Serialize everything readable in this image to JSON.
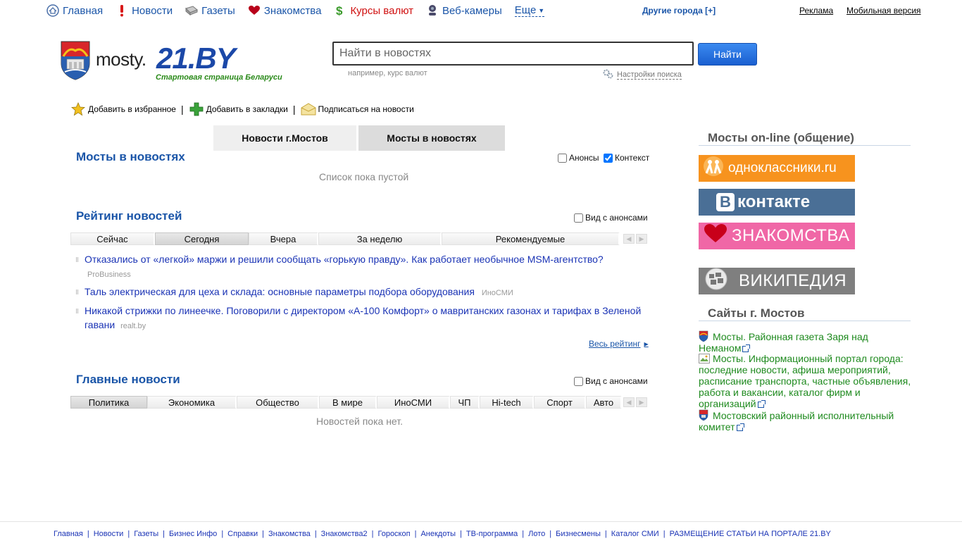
{
  "topnav": {
    "items": [
      {
        "label": "Главная",
        "icon": "home-icon"
      },
      {
        "label": "Новости",
        "icon": "exclamation-icon"
      },
      {
        "label": "Газеты",
        "icon": "newspaper-icon"
      },
      {
        "label": "Знакомства",
        "icon": "heart-icon"
      },
      {
        "label": "Курсы валют",
        "icon": "dollar-icon"
      },
      {
        "label": "Веб-камеры",
        "icon": "webcam-icon"
      }
    ],
    "more_label": "Еще",
    "other_cities": "Другие города [+]",
    "ads": "Реклама",
    "mobile": "Мобильная версия"
  },
  "logo": {
    "city": "mosty.",
    "brand": "21.BY",
    "slogan": "Стартовая страница Беларуси"
  },
  "search": {
    "placeholder": "Найти в новостях",
    "button": "Найти",
    "hint": "например, курс валют",
    "settings": "Настройки поиска"
  },
  "actions": {
    "favorites": "Добавить в избранное",
    "bookmarks": "Добавить в закладки",
    "subscribe": "Подписаться на новости"
  },
  "tabs": {
    "city_news": "Новости г.Мостов",
    "mosty_news": "Мосты в новостях"
  },
  "mosty_section": {
    "title": "Мосты в новостях",
    "announcements_label": "Анонсы",
    "context_label": "Контекст",
    "empty": "Список пока пустой"
  },
  "rating": {
    "title": "Рейтинг новостей",
    "with_announcements": "Вид с анонсами",
    "tabs": [
      "Сейчас",
      "Сегодня",
      "Вчера",
      "За неделю",
      "Рекомендуемые"
    ],
    "news": [
      {
        "title": "Отказались от «легкой» маржи и решили сообщать «горькую правду». Как работает необычное MSM-агентство?",
        "source": "ProBusiness"
      },
      {
        "title": "Таль электрическая для цеха и склада: основные параметры подбора оборудования",
        "source": "ИноСМИ"
      },
      {
        "title": "Никакой стрижки по линеечке. Поговорили с директором «А-100 Комфорт» о мавританских газонах и тарифах в Зеленой гавани",
        "source": "realt.by"
      }
    ],
    "all_link": "Весь рейтинг"
  },
  "main_news": {
    "title": "Главные новости",
    "with_announcements": "Вид с анонсами",
    "tabs": [
      "Политика",
      "Экономика",
      "Общество",
      "В мире",
      "ИноСМИ",
      "ЧП",
      "Hi-tech",
      "Спорт",
      "Авто"
    ],
    "empty": "Новостей пока нет."
  },
  "sidebar": {
    "online_title": "Мосты on-line (общение)",
    "banners": {
      "ok": "одноклассники.ru",
      "vk": "контакте",
      "vk_letter": "В",
      "znak": "ЗНАКОМСТВА",
      "wiki": "ВИКИПЕДИЯ"
    },
    "sites_title": "Сайты г. Мостов",
    "sites": [
      "Мосты. Районная газета Заря над Неманом",
      "Мосты. Информационный портал города: последние новости, афиша мероприятий, расписание транспорта, частные объявления, работа и вакансии, каталог фирм и организаций",
      "Мостовский районный исполнительный комитет"
    ]
  },
  "footer": {
    "links": [
      "Главная",
      "Новости",
      "Газеты",
      "Бизнес Инфо",
      "Справки",
      "Знакомства",
      "Знакомства2",
      "Гороскоп",
      "Анекдоты",
      "ТВ-программа",
      "Лото",
      "Бизнесмены",
      "Каталог СМИ",
      "РАЗМЕЩЕНИЕ СТАТЬИ НА ПОРТАЛЕ 21.BY"
    ]
  },
  "colors": {
    "link_blue": "#1a55a8",
    "news_blue": "#1a33b5",
    "site_green": "#1e8a1e",
    "brand_blue": "#1b48a8",
    "slogan_green": "#2a8a1a"
  }
}
